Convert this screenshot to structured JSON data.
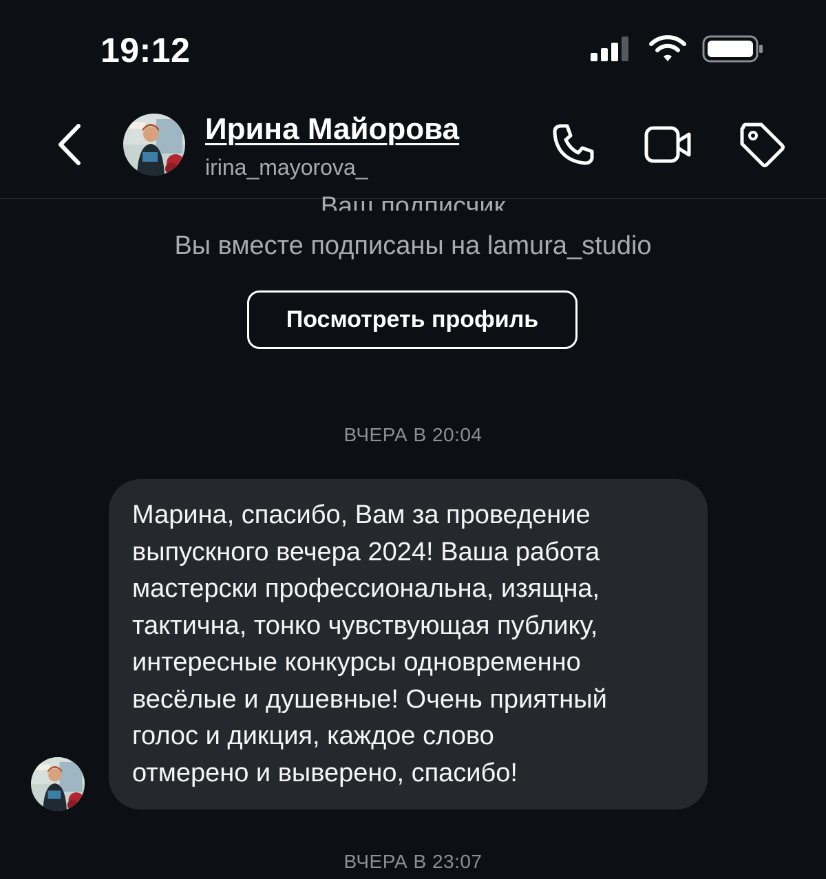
{
  "status_bar": {
    "time": "19:12",
    "icons": [
      "signal-icon",
      "wifi-icon",
      "battery-icon"
    ]
  },
  "header": {
    "back_icon": "chevron-left-icon",
    "contact_name": "Ирина Майорова",
    "contact_handle": "irina_mayorova_",
    "actions": [
      "phone-icon",
      "video-icon",
      "tag-icon"
    ]
  },
  "profile_info": {
    "follower_text": "Ваш подписчик",
    "mutual_text": "Вы вместе подписаны на lamura_studio",
    "view_profile_label": "Посмотреть профиль"
  },
  "messages": [
    {
      "timestamp": "ВЧЕРА В 20:04",
      "lines": [
        "Марина, спасибо, Вам за проведение",
        "выпускного вечера 2024!  Ваша работа",
        "мастерски профессиональна, изящна,",
        "тактична, тонко чувствующая публику,",
        "интересные конкурсы одновременно",
        "весёлые и душевные! Очень приятный",
        "голос и дикция, каждое слово",
        "отмерено и выверено, спасибо!"
      ]
    }
  ],
  "next_timestamp": "ВЧЕРА В 23:07",
  "colors": {
    "background": "#0c0f14",
    "bubble": "#25282d",
    "secondary_text": "#a8abb2"
  }
}
